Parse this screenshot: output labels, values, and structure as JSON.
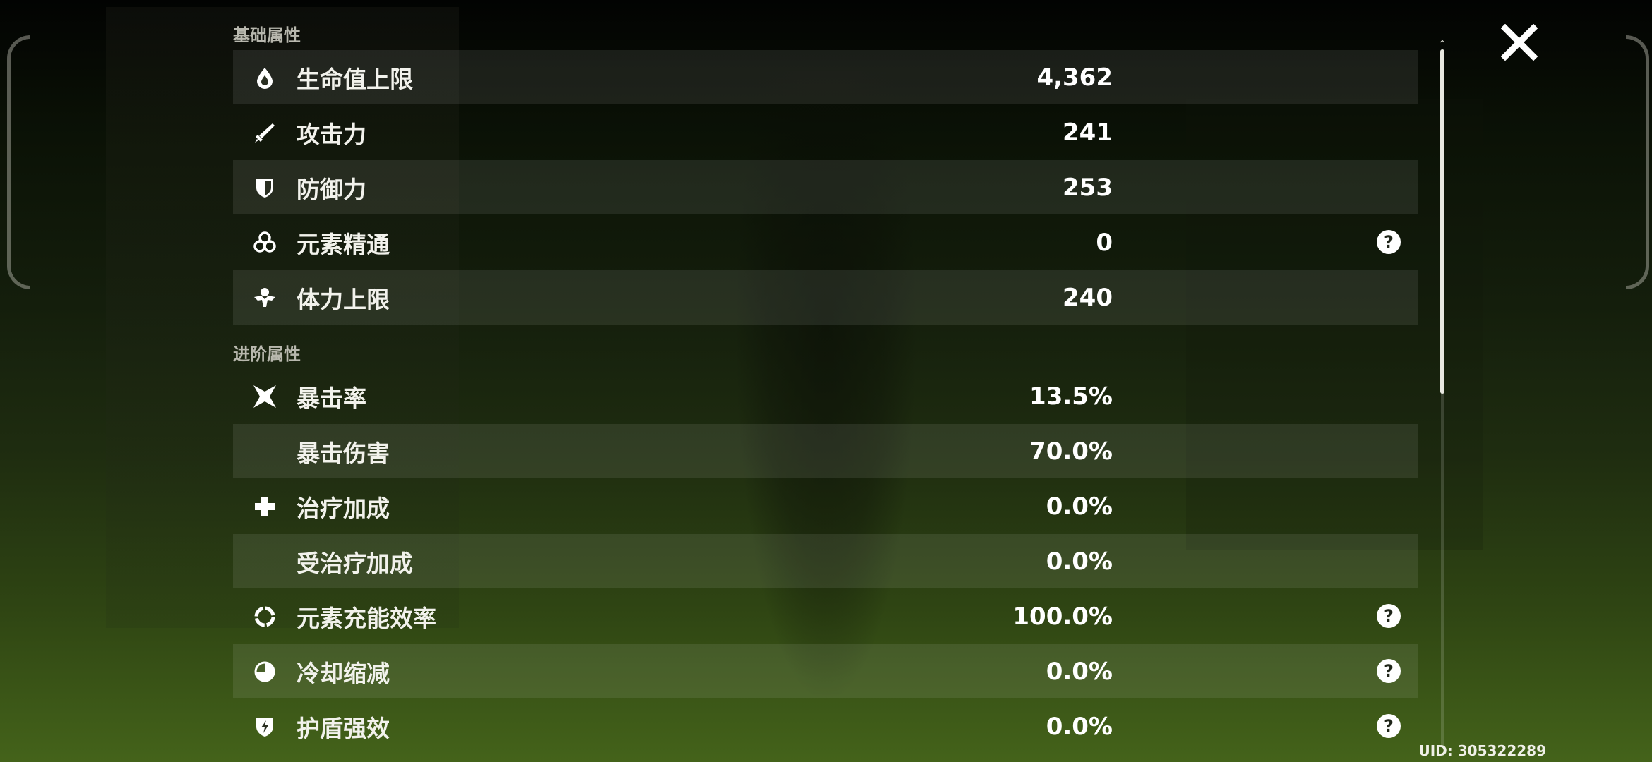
{
  "sections": {
    "basic_title": "基础属性",
    "advanced_title": "进阶属性"
  },
  "basic_stats": [
    {
      "label": "生命值上限",
      "value": "4,362",
      "icon": "hp-drop-icon"
    },
    {
      "label": "攻击力",
      "value": "241",
      "icon": "sword-icon"
    },
    {
      "label": "防御力",
      "value": "253",
      "icon": "shield-icon"
    },
    {
      "label": "元素精通",
      "value": "0",
      "icon": "elemental-mastery-icon",
      "has_help": true
    },
    {
      "label": "体力上限",
      "value": "240",
      "icon": "stamina-icon"
    }
  ],
  "advanced_stats": [
    {
      "label": "暴击率",
      "value": "13.5%",
      "icon": "crit-star-icon"
    },
    {
      "label": "暴击伤害",
      "value": "70.0%"
    },
    {
      "label": "治疗加成",
      "value": "0.0%",
      "icon": "cross-icon"
    },
    {
      "label": "受治疗加成",
      "value": "0.0%"
    },
    {
      "label": "元素充能效率",
      "value": "100.0%",
      "icon": "energy-ring-icon",
      "has_help": true
    },
    {
      "label": "冷却缩减",
      "value": "0.0%",
      "icon": "cooldown-icon",
      "has_help": true
    },
    {
      "label": "护盾强效",
      "value": "0.0%",
      "icon": "shield-strength-icon",
      "has_help": true
    }
  ],
  "uid": "UID: 305322289",
  "colors": {
    "row_alt": "rgba(255,255,255,0.085)",
    "section_title": "#b8b8ae"
  }
}
